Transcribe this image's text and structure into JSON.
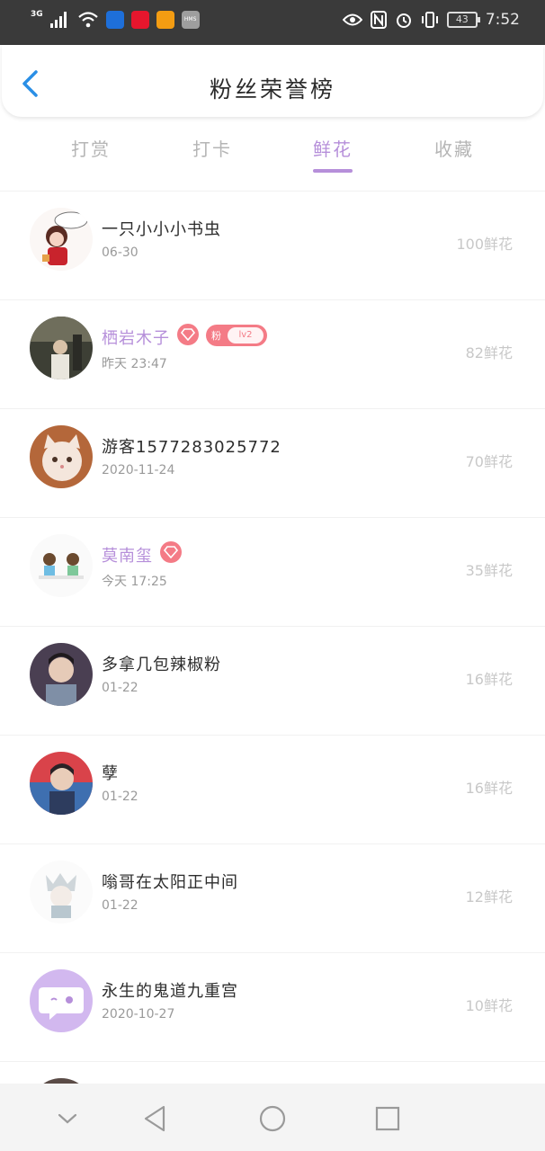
{
  "status_bar": {
    "network": "3G",
    "battery": "43",
    "time": "7:52",
    "icons": [
      "signal-icon",
      "wifi-icon",
      "shield-app-icon",
      "weibo-app-icon",
      "package-app-icon",
      "hms-app-icon",
      "eye-icon",
      "nfc-icon",
      "alarm-icon",
      "vibrate-icon",
      "battery-icon"
    ],
    "hms_label": "HMS"
  },
  "header": {
    "title": "粉丝荣誉榜",
    "back_icon": "chevron-left-icon"
  },
  "tabs": [
    {
      "label": "打赏",
      "active": false
    },
    {
      "label": "打卡",
      "active": false
    },
    {
      "label": "鲜花",
      "active": true
    },
    {
      "label": "收藏",
      "active": false
    }
  ],
  "colors": {
    "accent": "#b68fda",
    "badge": "#f47b86",
    "back_arrow": "#2a8fe6",
    "inactive_tab": "#b5b5b5"
  },
  "fans": [
    {
      "name": "一只小小小书虫",
      "date": "06-30",
      "count": "100鲜花",
      "vip": false,
      "avatar": "cartoon-avatar"
    },
    {
      "name": "栖岩木子",
      "date": "昨天 23:47",
      "count": "82鲜花",
      "vip": true,
      "fan_label": "粉",
      "level": "lv2",
      "avatar": "photo-avatar"
    },
    {
      "name": "游客1577283025772",
      "date": "2020-11-24",
      "count": "70鲜花",
      "vip": false,
      "avatar": "cat-avatar"
    },
    {
      "name": "莫南玺",
      "date": "今天 17:25",
      "count": "35鲜花",
      "vip": true,
      "avatar": "cartoon-avatar"
    },
    {
      "name": "多拿几包辣椒粉",
      "date": "01-22",
      "count": "16鲜花",
      "vip": false,
      "avatar": "photo-avatar"
    },
    {
      "name": "孽",
      "date": "01-22",
      "count": "16鲜花",
      "vip": false,
      "avatar": "photo-avatar"
    },
    {
      "name": "嗡哥在太阳正中间",
      "date": "01-22",
      "count": "12鲜花",
      "vip": false,
      "avatar": "cartoon-avatar"
    },
    {
      "name": "永生的鬼道九重宫",
      "date": "2020-10-27",
      "count": "10鲜花",
      "vip": false,
      "avatar": "default-chat-avatar"
    }
  ],
  "nav_bar": {
    "icons": [
      "collapse-icon",
      "back-triangle-icon",
      "home-circle-icon",
      "recents-square-icon"
    ]
  }
}
